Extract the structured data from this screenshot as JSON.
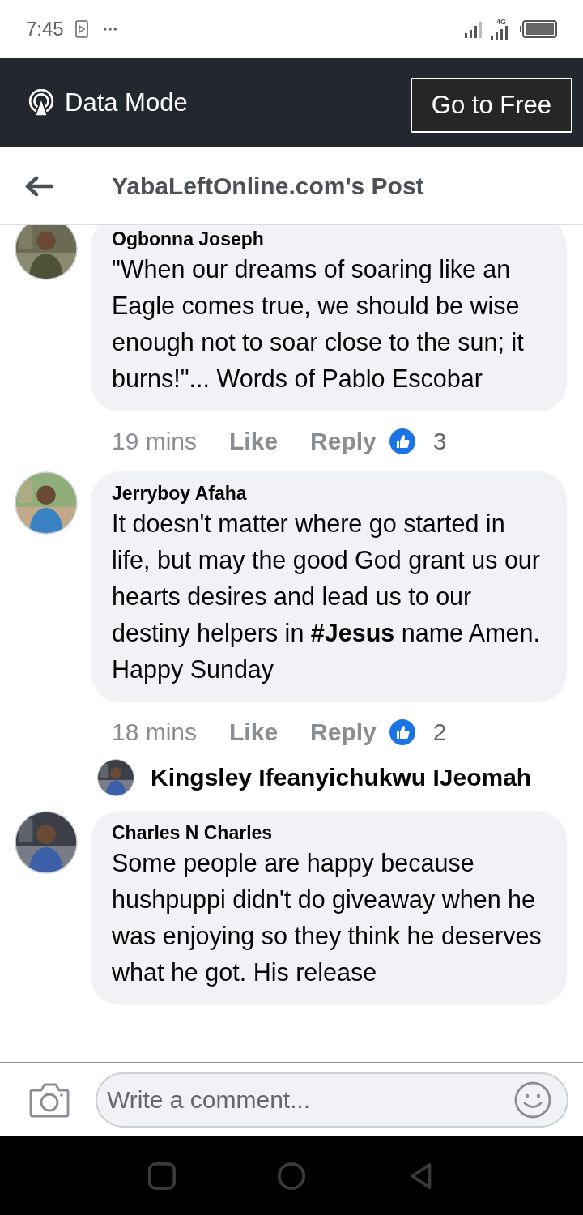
{
  "status_bar": {
    "time": "7:45",
    "network": "4G"
  },
  "data_mode_bar": {
    "label": "Data Mode",
    "button": "Go to Free"
  },
  "header": {
    "title": "YabaLeftOnline.com's Post"
  },
  "comments": [
    {
      "author": "Ogbonna Joseph",
      "text": "\"When our dreams of soaring like an Eagle comes true,  we should be wise enough not to soar close to the sun; it burns!\"... Words of  Pablo Escobar",
      "time": "19 mins",
      "like": "Like",
      "reply": "Reply",
      "reactions": "3"
    },
    {
      "author": "Jerryboy Afaha",
      "text": "It doesn't matter where go started in life, but may the good God grant us our hearts desires and lead us to our destiny helpers in **#Jesus** name Amen. Happy Sunday",
      "time": "18 mins",
      "like": "Like",
      "reply": "Reply",
      "reactions": "2",
      "reply_preview": {
        "author": "Kingsley Ifeanyichukwu IJeomah"
      }
    },
    {
      "author": "Charles N Charles",
      "text": "Some people are happy because hushpuppi didn't do giveaway when he was enjoying so they think he deserves what he got. His release"
    }
  ],
  "composer": {
    "placeholder": "Write a comment..."
  }
}
